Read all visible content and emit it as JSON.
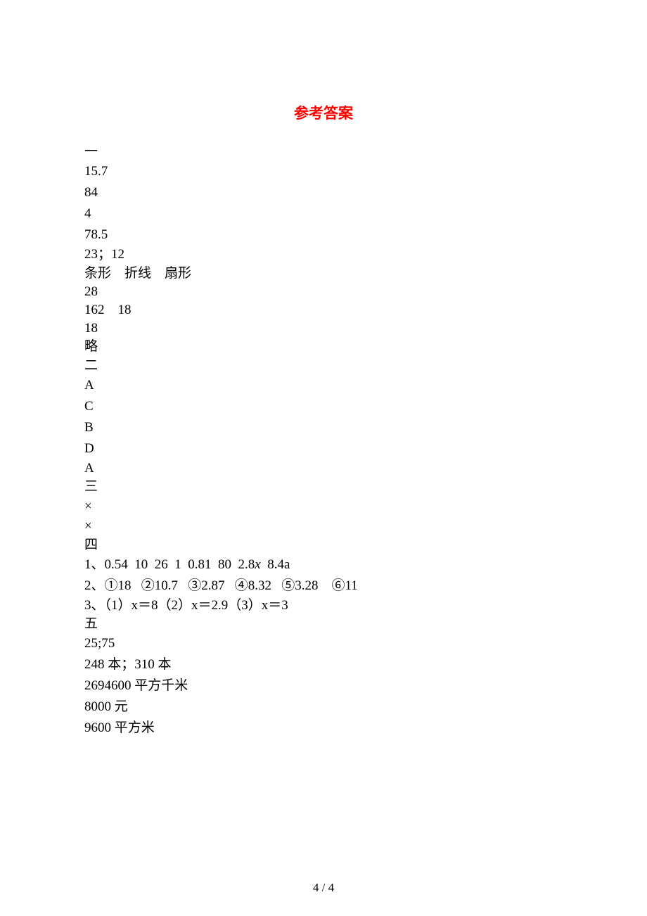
{
  "title": "参考答案",
  "sections": {
    "one": {
      "heading": "一",
      "lines": [
        "15.7",
        "84",
        "4",
        "78.5",
        "23；12",
        "条形    折线    扇形",
        "28",
        "162    18",
        "18",
        "略"
      ]
    },
    "two": {
      "heading": "二",
      "lines": [
        "A",
        "C",
        "B",
        "D",
        "A"
      ]
    },
    "three": {
      "heading": "三",
      "lines": [
        "×",
        "×"
      ]
    },
    "four": {
      "heading": "四",
      "q1_prefix": "1、0.54  10  26  1  0.81  80  2.8",
      "q1_var1": "x",
      "q1_mid": "  8.4a",
      "q2": "2、①18   ②10.7   ③2.87   ④8.32   ⑤3.28    ⑥11",
      "q3": "3、（1）x＝8（2）x＝2.9（3）x＝3"
    },
    "five": {
      "heading": "五",
      "lines": [
        "25;75",
        "248 本；310 本",
        "2694600 平方千米",
        "8000 元",
        "9600 平方米"
      ]
    }
  },
  "footer": "4 / 4"
}
